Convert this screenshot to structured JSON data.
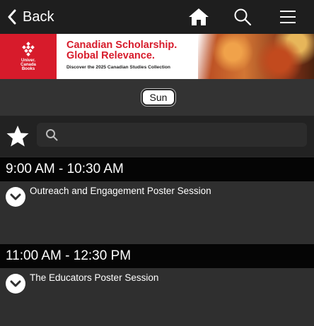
{
  "header": {
    "back_label": "Back",
    "icons": [
      "chevron-left-icon",
      "home-icon",
      "search-icon",
      "hamburger-menu-icon"
    ]
  },
  "banner": {
    "logo_text": "Univer. Canada Books",
    "headline_line1": "Canadian Scholarship.",
    "headline_line2": "Global Relevance.",
    "subline": "Discover the 2025 Canadian Studies Collection",
    "accent_color": "#d71b2b"
  },
  "day_selector": {
    "selected": "Sun"
  },
  "search": {
    "value": "",
    "placeholder": ""
  },
  "schedule": [
    {
      "time": "9:00 AM - 10:30 AM",
      "title": "Outreach and Engagement Poster Session"
    },
    {
      "time": "11:00 AM - 12:30 PM",
      "title": "The Educators Poster Session"
    }
  ]
}
